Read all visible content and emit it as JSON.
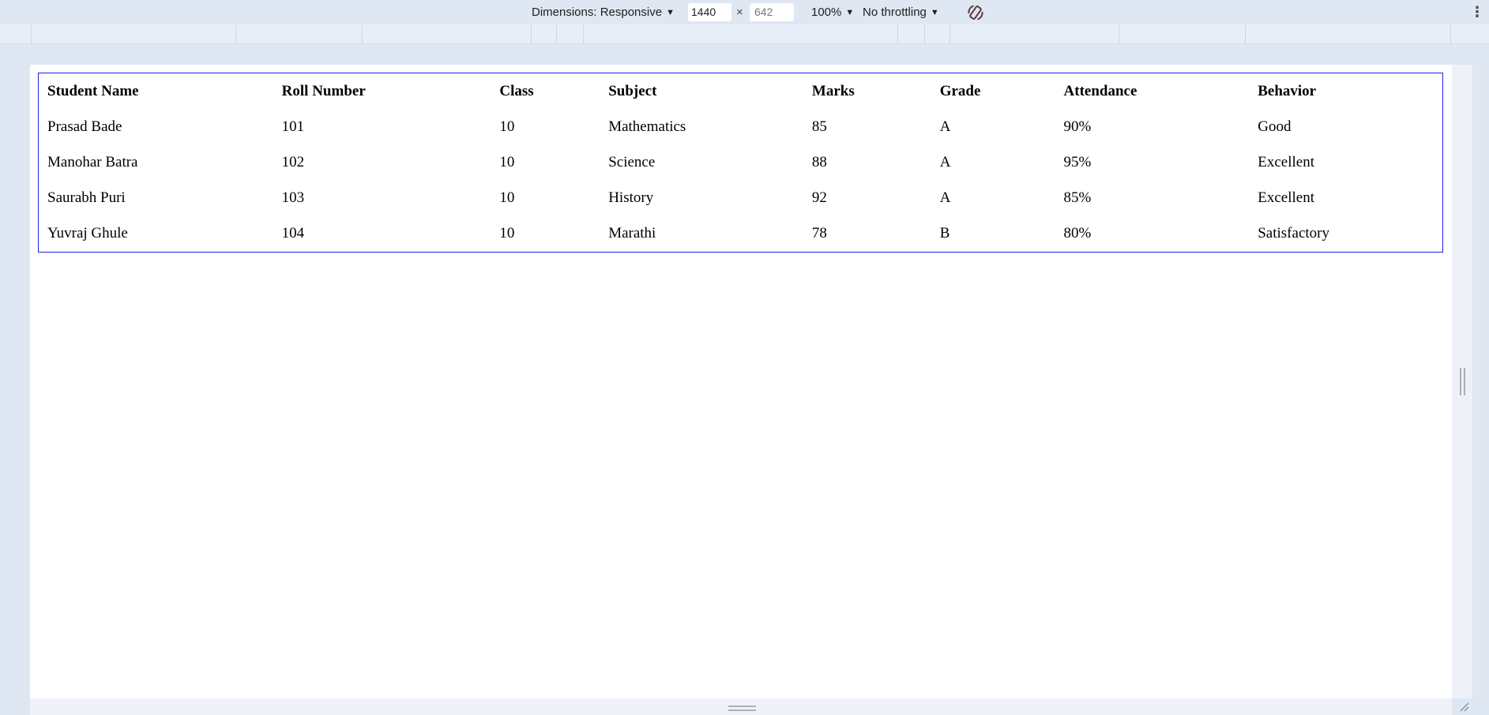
{
  "toolbar": {
    "dimensions_label": "Dimensions: Responsive",
    "width_value": "1440",
    "height_placeholder": "642",
    "times_symbol": "×",
    "zoom_label": "100%",
    "throttling_label": "No throttling",
    "caret_symbol": "▼",
    "menu_symbol": "⋮",
    "icons": [
      "rotate-icon",
      "more-options-icon",
      "caret-down-icon"
    ]
  },
  "table": {
    "headers": [
      "Student Name",
      "Roll Number",
      "Class",
      "Subject",
      "Marks",
      "Grade",
      "Attendance",
      "Behavior"
    ],
    "rows": [
      [
        "Prasad Bade",
        "101",
        "10",
        "Mathematics",
        "85",
        "A",
        "90%",
        "Good"
      ],
      [
        "Manohar Batra",
        "102",
        "10",
        "Science",
        "88",
        "A",
        "95%",
        "Excellent"
      ],
      [
        "Saurabh Puri",
        "103",
        "10",
        "History",
        "92",
        "A",
        "85%",
        "Excellent"
      ],
      [
        "Yuvraj Ghule",
        "104",
        "10",
        "Marathi",
        "78",
        "B",
        "80%",
        "Satisfactory"
      ]
    ],
    "border_color": "#1f1fe6"
  },
  "colors": {
    "devtools_background": "#dfe7f3",
    "viewport_background": "#ffffff"
  }
}
